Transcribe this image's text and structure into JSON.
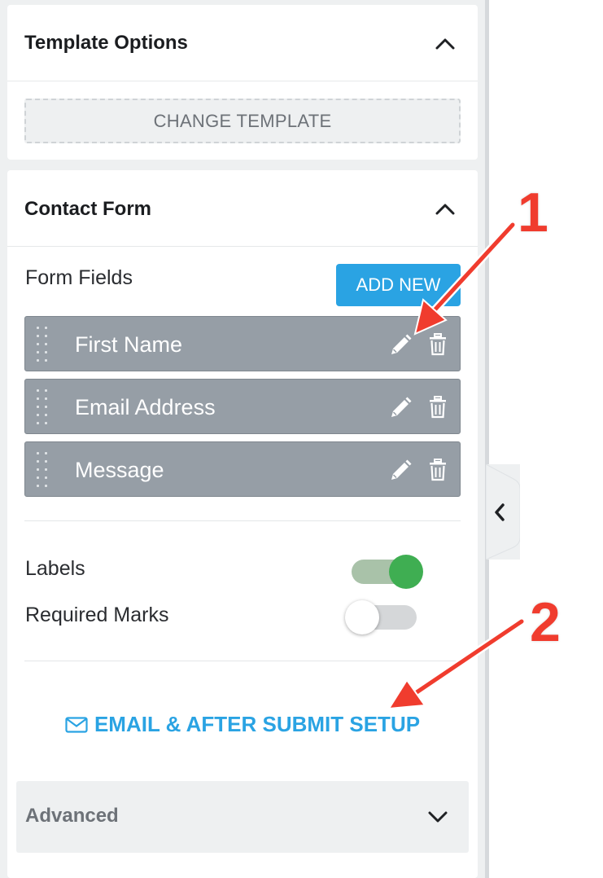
{
  "template_options": {
    "title": "Template Options",
    "change_template_label": "CHANGE TEMPLATE"
  },
  "contact_form": {
    "title": "Contact Form",
    "form_fields_label": "Form Fields",
    "add_new_label": "ADD NEW",
    "fields": [
      {
        "label": "First Name"
      },
      {
        "label": "Email Address"
      },
      {
        "label": "Message"
      }
    ],
    "toggles": {
      "labels": {
        "label": "Labels",
        "on": true
      },
      "required_marks": {
        "label": "Required Marks",
        "on": false
      }
    },
    "email_setup_label": "EMAIL & AFTER SUBMIT SETUP"
  },
  "advanced": {
    "title": "Advanced"
  },
  "annotations": {
    "marker_1": "1",
    "marker_2": "2"
  },
  "colors": {
    "accent_blue": "#2aa3e3",
    "toggle_on": "#3fae52",
    "field_row": "#969ea6",
    "annotation_red": "#f03c2e"
  },
  "icons": {
    "collapse": "chevron-left-icon",
    "section_toggle": "chevron-up-icon",
    "advanced_toggle": "chevron-down-icon",
    "edit": "pencil-icon",
    "delete": "trash-icon",
    "drag": "drag-handle-icon",
    "email": "envelope-icon"
  }
}
